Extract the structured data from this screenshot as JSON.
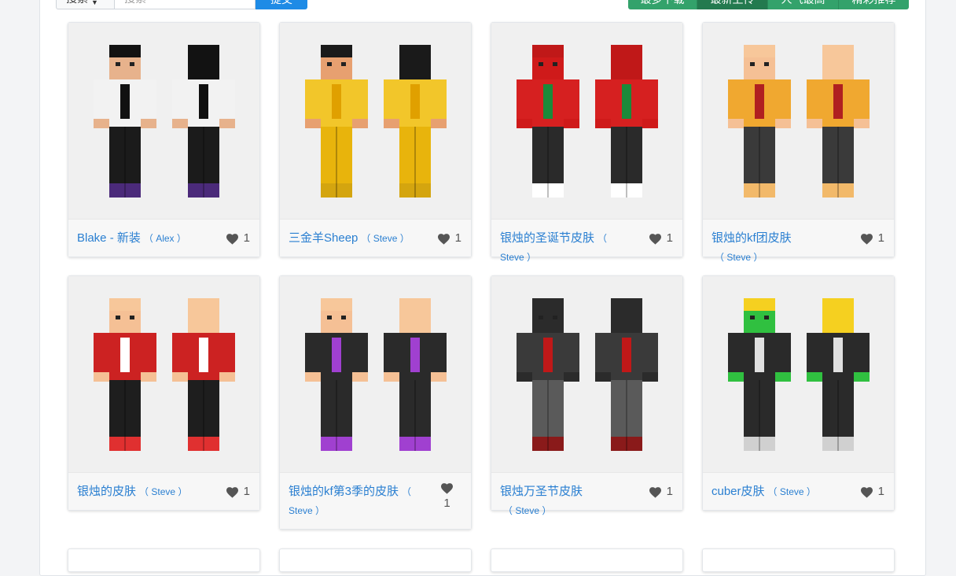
{
  "toolbar": {
    "search_type": "搜索",
    "search_placeholder": "搜索",
    "submit_label": "提交",
    "sort_buttons": [
      "最多下载",
      "最新上传",
      "人气最高",
      "精彩推荐"
    ]
  },
  "colors": {
    "link": "#2a7fd1",
    "submit": "#1e8be6",
    "sort": "#33a26b",
    "sort_active": "#237a4f"
  },
  "skins": [
    {
      "name": "Blake - 新装",
      "model": "（ Alex ）",
      "likes": "1",
      "colors": {
        "hair": "#121212",
        "body": "#f2f2f2",
        "accent": "#111111",
        "legs": "#1b1b1b",
        "trim": "#4b2a7a",
        "face": "#e7b28c"
      }
    },
    {
      "name": "三金羊Sheep",
      "model": "（ Steve ）",
      "likes": "1",
      "colors": {
        "hair": "#1a1a1a",
        "body": "#f2c62a",
        "accent": "#e0a000",
        "legs": "#e8b40c",
        "trim": "#d4a50f",
        "face": "#e7a070"
      }
    },
    {
      "name": "银烛的圣诞节皮肤",
      "model": "（ Steve ）",
      "likes": "1",
      "colors": {
        "hair": "#c01818",
        "body": "#d62020",
        "accent": "#1a8a3a",
        "legs": "#2a2a2a",
        "trim": "#ffffff",
        "face": "#cf1a1a"
      }
    },
    {
      "name": "银烛的kf团皮肤",
      "model": "（ Steve ）",
      "likes": "1",
      "colors": {
        "hair": "#f7c79a",
        "body": "#f0a830",
        "accent": "#b02020",
        "legs": "#3a3a3a",
        "trim": "#f2b96a",
        "face": "#f5c095"
      }
    },
    {
      "name": "银烛的皮肤",
      "model": "（ Steve ）",
      "likes": "1",
      "colors": {
        "hair": "#f7c79a",
        "body": "#cc2222",
        "accent": "#ffffff",
        "legs": "#1e1e1e",
        "trim": "#e03030",
        "face": "#f5c095"
      }
    },
    {
      "name": "银烛的kf第3季的皮肤",
      "model": "（ Steve ）",
      "likes": "1",
      "colors": {
        "hair": "#f7c79a",
        "body": "#2a2a2a",
        "accent": "#a040d0",
        "legs": "#2a2a2a",
        "trim": "#a040d0",
        "face": "#f5c095"
      }
    },
    {
      "name": "银烛万圣节皮肤",
      "model": "（ Steve ）",
      "likes": "1",
      "colors": {
        "hair": "#2b2b2b",
        "body": "#3a3a3a",
        "accent": "#c01818",
        "legs": "#5a5a5a",
        "trim": "#8a1a1a",
        "face": "#2b2b2b"
      }
    },
    {
      "name": "cuber皮肤",
      "model": "（ Steve ）",
      "likes": "1",
      "colors": {
        "hair": "#f5d020",
        "body": "#2a2a2a",
        "accent": "#e0e0e0",
        "legs": "#2a2a2a",
        "trim": "#d0d0d0",
        "face": "#30c040"
      }
    }
  ]
}
